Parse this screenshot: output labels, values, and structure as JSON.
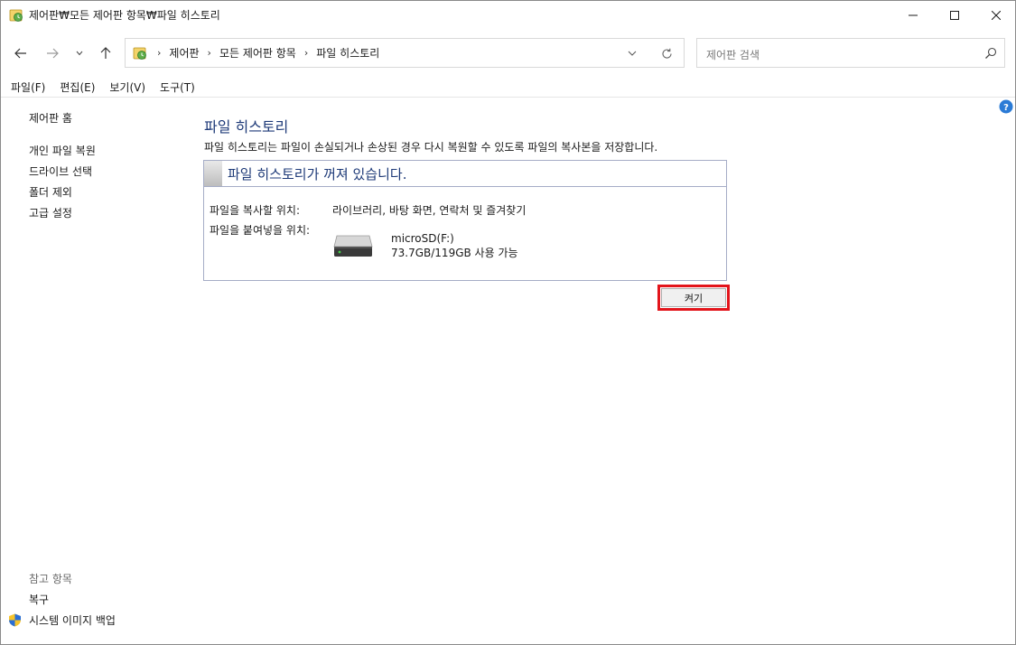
{
  "window": {
    "title": "제어판₩모든 제어판 항목₩파일 히스토리"
  },
  "address_bar": {
    "crumbs": [
      "제어판",
      "모든 제어판 항목",
      "파일 히스토리"
    ],
    "separator": "›"
  },
  "search": {
    "placeholder": "제어판 검색"
  },
  "menu": {
    "items": [
      "파일(F)",
      "편집(E)",
      "보기(V)",
      "도구(T)"
    ]
  },
  "sidebar": {
    "home": "제어판 홈",
    "links": [
      "개인 파일 복원",
      "드라이브 선택",
      "폴더 제외",
      "고급 설정"
    ],
    "see_also_label": "참고 항목",
    "see_also_links": [
      "복구",
      "시스템 이미지 백업"
    ]
  },
  "main": {
    "title": "파일 히스토리",
    "description": "파일 히스토리는 파일이 손실되거나 손상된 경우 다시 복원할 수 있도록 파일의 복사본을 저장합니다.",
    "status_title": "파일 히스토리가 꺼져 있습니다.",
    "copy_from_label": "파일을 복사할 위치:",
    "copy_from_value": "라이브러리, 바탕 화면, 연락처 및 즐겨찾기",
    "copy_to_label": "파일을 붙여넣을 위치:",
    "drive_name": "microSD(F:)",
    "drive_space": "73.7GB/119GB 사용 가능",
    "turn_on_button": "켜기"
  },
  "colors": {
    "accent_title": "#1e3a78",
    "highlight_box": "#e3141b",
    "panel_border": "#a5acc6"
  },
  "icons": {
    "app": "control-panel-file-history-icon",
    "help": "help-icon",
    "drive": "hard-drive-icon",
    "shield": "uac-shield-icon"
  }
}
